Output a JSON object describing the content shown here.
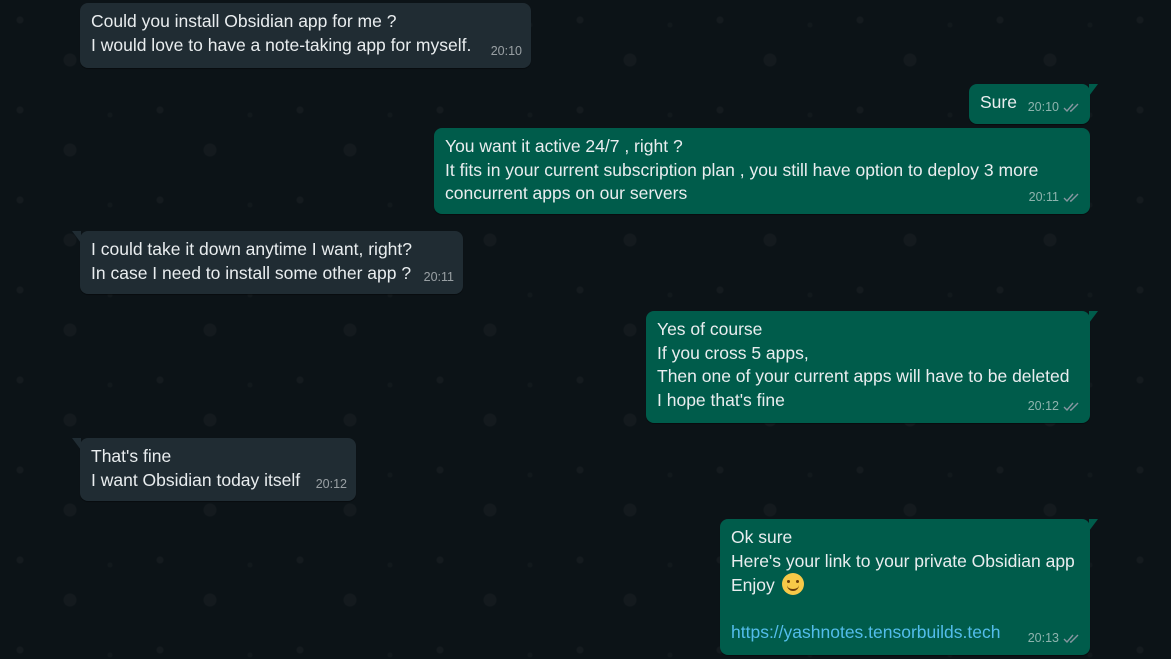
{
  "messages": [
    {
      "dir": "in",
      "lines": [
        "Could you install Obsidian app for me ?",
        "I would love to have a note-taking app for myself."
      ],
      "time": "20:10"
    },
    {
      "dir": "out",
      "lines": [
        "Sure"
      ],
      "time": "20:10"
    },
    {
      "dir": "out",
      "lines": [
        "You want it active 24/7 , right ?",
        "It fits in your current subscription plan , you still have option to deploy 3 more",
        "concurrent apps on our servers"
      ],
      "time": "20:11"
    },
    {
      "dir": "in",
      "lines": [
        "I could take it down anytime I want, right?",
        "In case I need to install some other app ?"
      ],
      "time": "20:11"
    },
    {
      "dir": "out",
      "lines": [
        "Yes of course",
        "If you cross 5 apps,",
        "Then one of your current apps will have to be deleted",
        "I hope that's fine"
      ],
      "time": "20:12"
    },
    {
      "dir": "in",
      "lines": [
        "That's fine",
        "I want Obsidian today itself"
      ],
      "time": "20:12"
    },
    {
      "dir": "out",
      "lines": [
        "Ok sure",
        "Here's your link to your private Obsidian app",
        "Enjoy"
      ],
      "emoji": "smiling-face-emoji",
      "link": "https://yashnotes.tensorbuilds.tech",
      "time": "20:13"
    }
  ],
  "colors": {
    "incoming_bubble": "#202c33",
    "outgoing_bubble": "#005c4b",
    "background": "#0b141a",
    "link": "#53bdeb",
    "read_ticks": "#8696a0"
  },
  "icons": {
    "read_receipt": "double-check-icon"
  }
}
